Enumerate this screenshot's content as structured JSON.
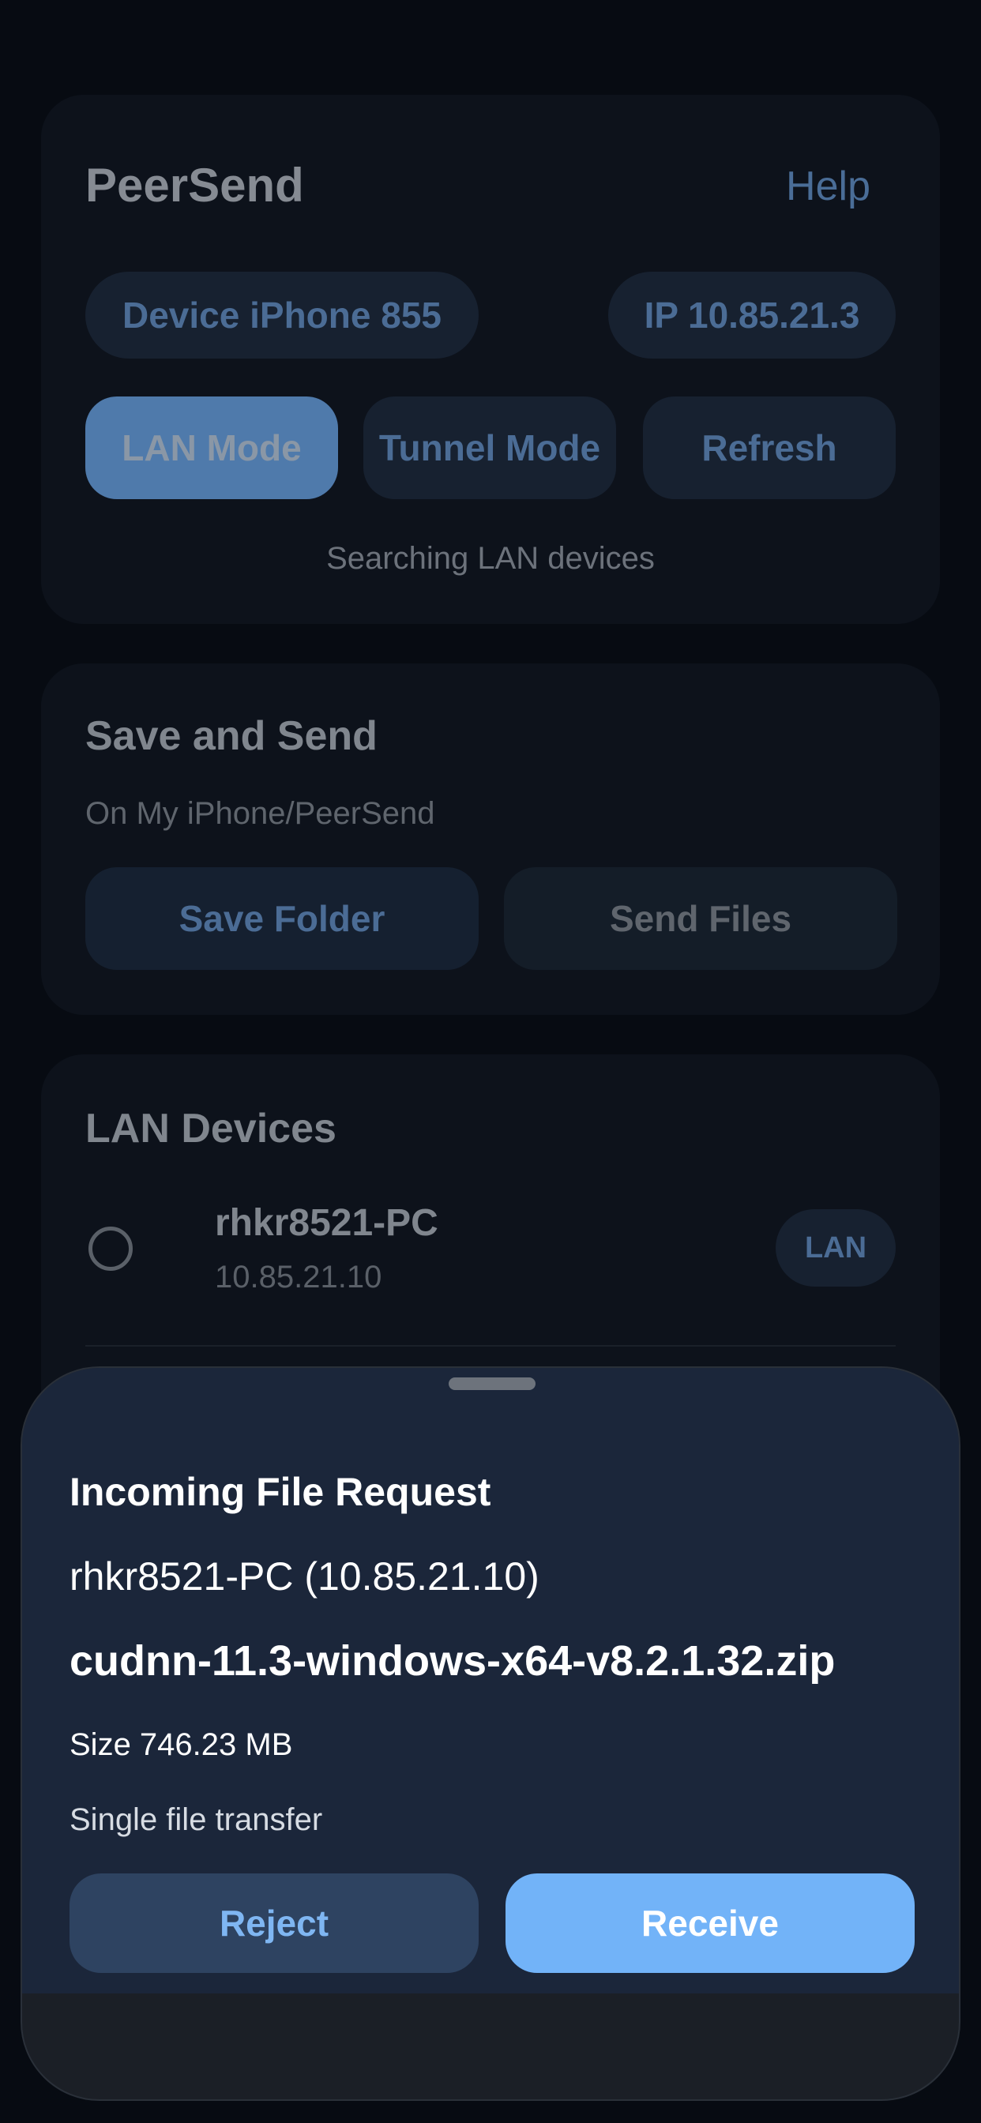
{
  "header": {
    "title": "PeerSend",
    "help_label": "Help",
    "device_label": "Device iPhone 855",
    "ip_label": "IP 10.85.21.3",
    "modes": {
      "lan": "LAN Mode",
      "tunnel": "Tunnel Mode",
      "refresh": "Refresh"
    },
    "status": "Searching LAN devices"
  },
  "save_send": {
    "title": "Save and Send",
    "path": "On My iPhone/PeerSend",
    "save_folder_label": "Save Folder",
    "send_files_label": "Send Files"
  },
  "lan_devices": {
    "title": "LAN Devices",
    "items": [
      {
        "name": "rhkr8521-PC",
        "ip": "10.85.21.10",
        "badge": "LAN"
      }
    ]
  },
  "request_sheet": {
    "title": "Incoming File Request",
    "sender": "rhkr8521-PC (10.85.21.10)",
    "file_name": "cudnn-11.3-windows-x64-v8.2.1.32.zip",
    "size": "Size 746.23 MB",
    "mode": "Single file transfer",
    "reject_label": "Reject",
    "receive_label": "Receive"
  },
  "colors": {
    "accent": "#72b3f8",
    "background": "#070b12",
    "sheet": "#1b263a"
  }
}
